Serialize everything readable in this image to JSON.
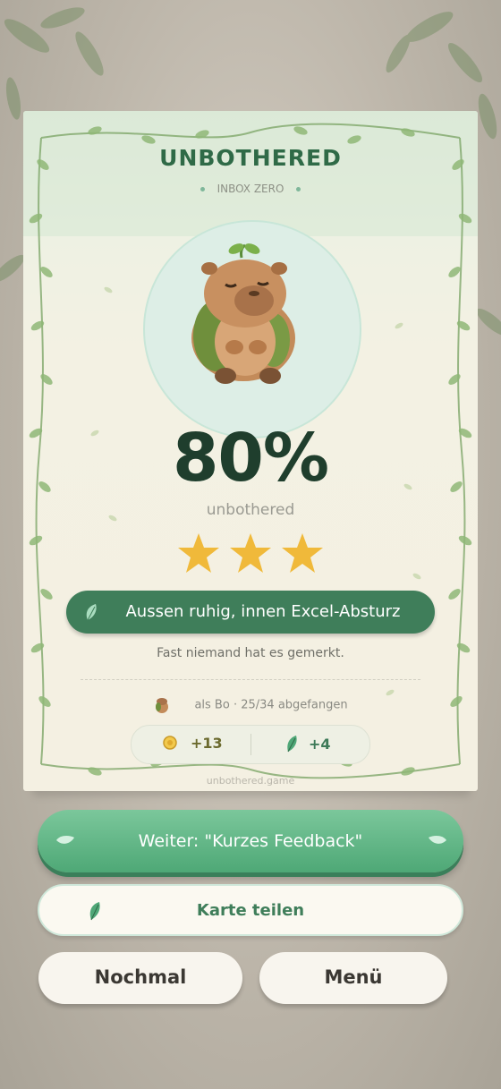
{
  "card": {
    "title": "UNBOTHERED",
    "subtitle": "INBOX ZERO",
    "avatar_icon": "capybara-avatar-icon",
    "percent": "80%",
    "percent_value": 80,
    "percent_label": "unbothered",
    "stars_filled": 3,
    "stars_total": 3,
    "star_color": "#f0b93a",
    "verdict": "Aussen ruhig, innen Excel-Absturz",
    "description": "Fast niemand hat es gemerkt.",
    "player_name": "als Bo",
    "separator": "·",
    "caught": "25/34 abgefangen",
    "coins": "+13",
    "leaves": "+4",
    "watermark": "unbothered.game"
  },
  "buttons": {
    "continue": "Weiter: \"Kurzes Feedback\"",
    "share": "Karte teilen",
    "again": "Nochmal",
    "menu": "Menü"
  },
  "colors": {
    "accent_green": "#3f7e5a",
    "primary_button": "#5fb585",
    "title_green": "#2f6a47"
  }
}
